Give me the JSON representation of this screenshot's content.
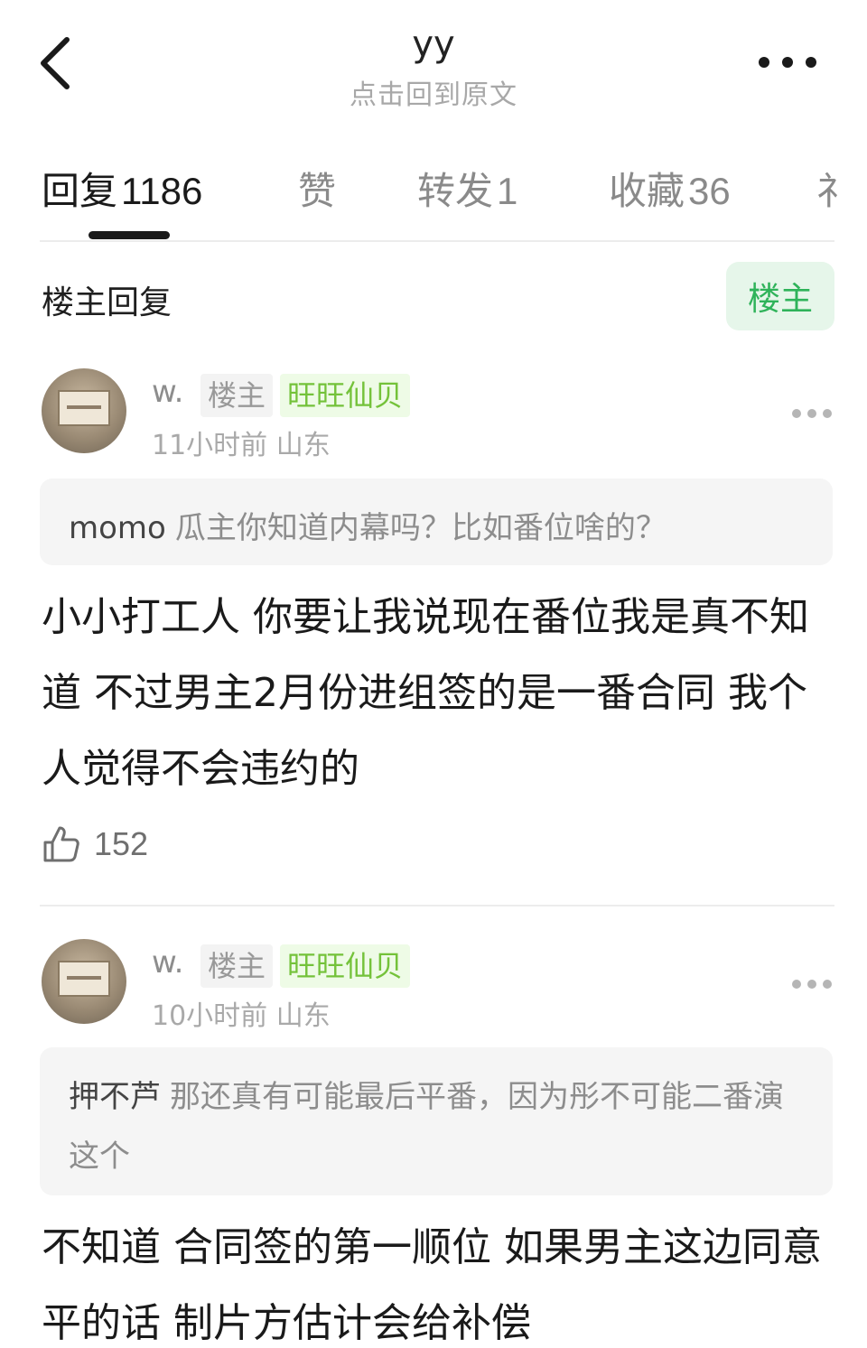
{
  "header": {
    "title": "yy",
    "subtitle": "点击回到原文"
  },
  "tabs": [
    {
      "label": "回复",
      "count": "1186",
      "active": true
    },
    {
      "label": "赞",
      "count": ""
    },
    {
      "label": "转发",
      "count": "1"
    },
    {
      "label": "收藏",
      "count": "36"
    },
    {
      "label": "礻",
      "count": ""
    }
  ],
  "section": {
    "title": "楼主回复",
    "filter_label": "楼主"
  },
  "comments": [
    {
      "username": "w.",
      "op_tag": "楼主",
      "fan_tag": "旺旺仙贝",
      "time": "11小时前",
      "location": "山东",
      "quote_user": "momo",
      "quote_text": "瓜主你知道内幕吗？比如番位啥的？",
      "body": "小小打工人 你要让我说现在番位我是真不知道 不过男主2月份进组签的是一番合同 我个人觉得不会违约的",
      "likes": "152"
    },
    {
      "username": "w.",
      "op_tag": "楼主",
      "fan_tag": "旺旺仙贝",
      "time": "10小时前",
      "location": "山东",
      "quote_user": "押不芦",
      "quote_text": "那还真有可能最后平番，因为彤不可能二番演这个",
      "body": "不知道 合同签的第一顺位 如果男主这边同意平的话 制片方估计会给补偿",
      "likes": ""
    }
  ],
  "icons": {
    "back": "chevron-left-icon",
    "more": "more-horizontal-icon",
    "like": "thumbs-up-icon"
  },
  "colors": {
    "accent_green": "#2fb35a",
    "fan_green": "#74c23a"
  }
}
